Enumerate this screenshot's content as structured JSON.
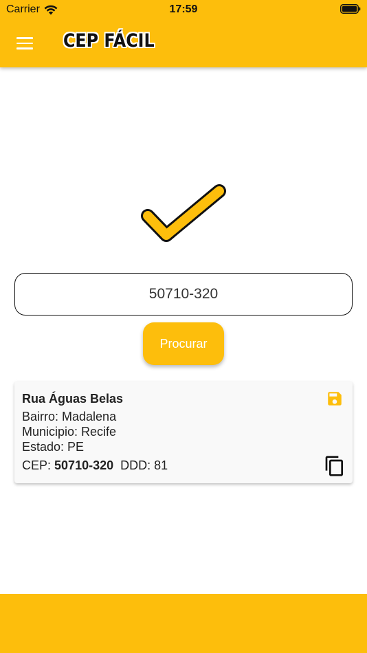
{
  "status_bar": {
    "carrier": "Carrier",
    "time": "17:59"
  },
  "app_bar": {
    "logo_text": "CEP FÁCIL"
  },
  "search": {
    "cep_value": "50710-320",
    "button_label": "Procurar"
  },
  "result": {
    "street": "Rua Águas Belas",
    "bairro_line": "Bairro: Madalena",
    "municipio_line": "Municipio: Recife",
    "estado_line": "Estado: PE",
    "cep_label": "CEP:",
    "cep_value": "50710-320",
    "ddd_line": "DDD: 81"
  },
  "icons": {
    "menu": "menu-icon",
    "check": "check-icon",
    "save": "save-icon",
    "copy": "copy-icon",
    "wifi": "wifi-icon",
    "battery": "battery-icon"
  },
  "colors": {
    "accent": "#FDBE0C",
    "text": "#222222",
    "card_bg": "#F9F9F9"
  }
}
